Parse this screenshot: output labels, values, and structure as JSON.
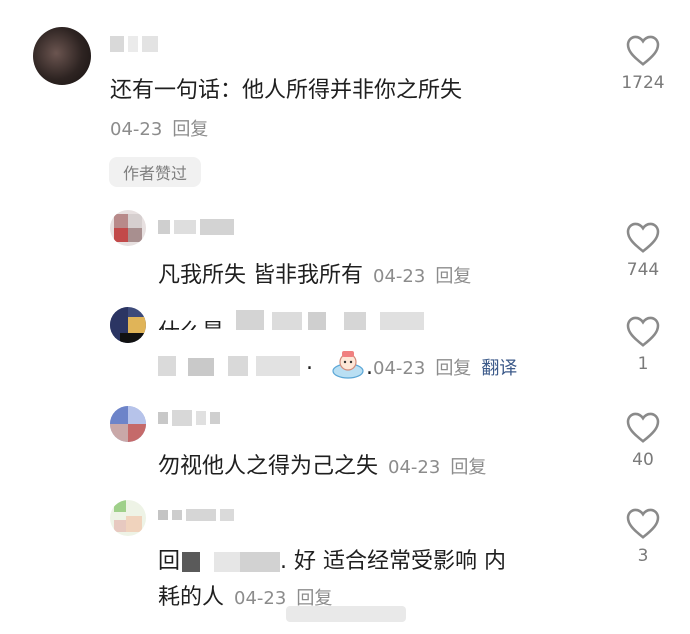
{
  "comments": [
    {
      "text": "还有一句话：他人所得并非你之所失",
      "date": "04-23",
      "reply_label": "回复",
      "likes": "1724",
      "badge": "作者赞过"
    }
  ],
  "replies": [
    {
      "text": "凡我所失 皆非我所有",
      "date": "04-23",
      "reply_label": "回复",
      "likes": "744"
    },
    {
      "text_visible": "什么是",
      "date": "04-23",
      "reply_label": "回复",
      "translate_label": "翻译",
      "likes": "1"
    },
    {
      "text": "勿视他人之得为己之失",
      "date": "04-23",
      "reply_label": "回复",
      "likes": "40"
    },
    {
      "prefix": "回",
      "text_line1": "好 适合经常受影响 内",
      "text_line2": "耗的人",
      "date": "04-23",
      "reply_label": "回复",
      "likes": "3"
    }
  ],
  "icons": {
    "like": "heart-outline-icon",
    "sticker": "emoji-sticker-icon"
  },
  "colors": {
    "text": "#1f1f1f",
    "meta": "#8c8c8c",
    "translate": "#3c5a8a",
    "badge_bg": "#f1f1f1"
  }
}
